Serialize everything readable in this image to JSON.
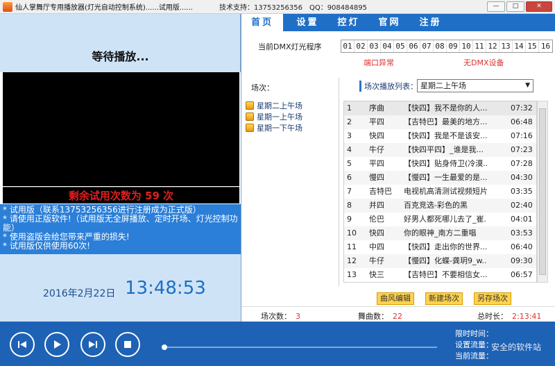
{
  "window": {
    "title": "仙人掌舞厅专用播放器(灯光自动控制系统)......试用版......",
    "support": "技术支持：13753256356",
    "qq": "QQ：908484895"
  },
  "left": {
    "status_title": "等待播放...",
    "trial_text": "剩余试用次数为 59 次",
    "notice_lines": [
      "* 试用版（联系13753256356进行注册成为正式版）",
      "* 请使用正版软件!（试用版无全屏播放、定时开场、灯光控制功能）",
      "* 使用盗版会给您带来严重的损失!",
      "* 试用版仅供使用60次!"
    ],
    "date": "2016年2月22日",
    "time": "13:48:53"
  },
  "tabs": [
    {
      "label": "首页",
      "active": true
    },
    {
      "label": "设置"
    },
    {
      "label": "控灯"
    },
    {
      "label": "官网"
    },
    {
      "label": "注册"
    }
  ],
  "dmx": {
    "label": "当前DMX灯光程序",
    "channels": [
      "01",
      "02",
      "03",
      "04",
      "05",
      "06",
      "07",
      "08",
      "09",
      "10",
      "11",
      "12",
      "13",
      "14",
      "15",
      "16"
    ],
    "port_status": "端口异常",
    "device_status": "无DMX设备"
  },
  "scenes": {
    "label": "场次：",
    "items": [
      "星期二上午场",
      "星期一上午场",
      "星期一下午场"
    ]
  },
  "playlist": {
    "label": "场次播放列表：",
    "selected": "星期二上午场",
    "rows": [
      {
        "num": "1",
        "type": "序曲",
        "name": "【快四】我不是你的人...",
        "dur": "07:32"
      },
      {
        "num": "2",
        "type": "平四",
        "name": "【吉特巴】最美的地方...",
        "dur": "06:48"
      },
      {
        "num": "3",
        "type": "快四",
        "name": "【快四】我是不是该安...",
        "dur": "07:16"
      },
      {
        "num": "4",
        "type": "牛仔",
        "name": "【快四平四】_谁是我...",
        "dur": "07:23"
      },
      {
        "num": "5",
        "type": "平四",
        "name": "【快四】贴身侍卫(冷漠...",
        "dur": "07:28"
      },
      {
        "num": "6",
        "type": "慢四",
        "name": "【慢四】一生最爱的是...",
        "dur": "04:30"
      },
      {
        "num": "7",
        "type": "吉特巴",
        "name": "电视机高清测试视频短片.",
        "dur": "03:35"
      },
      {
        "num": "8",
        "type": "并四",
        "name": "百克竞选-彩色的黑",
        "dur": "02:40"
      },
      {
        "num": "9",
        "type": "伦巴",
        "name": "好男人都死哪儿去了_崔...",
        "dur": "04:01"
      },
      {
        "num": "10",
        "type": "快四",
        "name": "你的眼神_南方二重唱",
        "dur": "03:53"
      },
      {
        "num": "11",
        "type": "中四",
        "name": "【快四】走出你的世界...",
        "dur": "06:40"
      },
      {
        "num": "12",
        "type": "牛仔",
        "name": "【慢四】化蝶-龚玥9_w...",
        "dur": "09:30"
      },
      {
        "num": "13",
        "type": "快三",
        "name": "【吉特巴】不要相信女...",
        "dur": "06:57"
      }
    ]
  },
  "actions": {
    "edit": "曲风编辑",
    "new_scene": "新建场次",
    "save_as": "另存场次"
  },
  "stats": {
    "scenes_label": "场次数：",
    "scenes_value": "3",
    "songs_label": "舞曲数：",
    "songs_value": "22",
    "total_label": "总时长：",
    "total_value": "2:13:41"
  },
  "bottom": {
    "limit_time": "限时时间：",
    "set_amount": "设置流量：",
    "current_amount": "当前流量：",
    "watermark": "安全的软件站"
  },
  "progress": 0
}
